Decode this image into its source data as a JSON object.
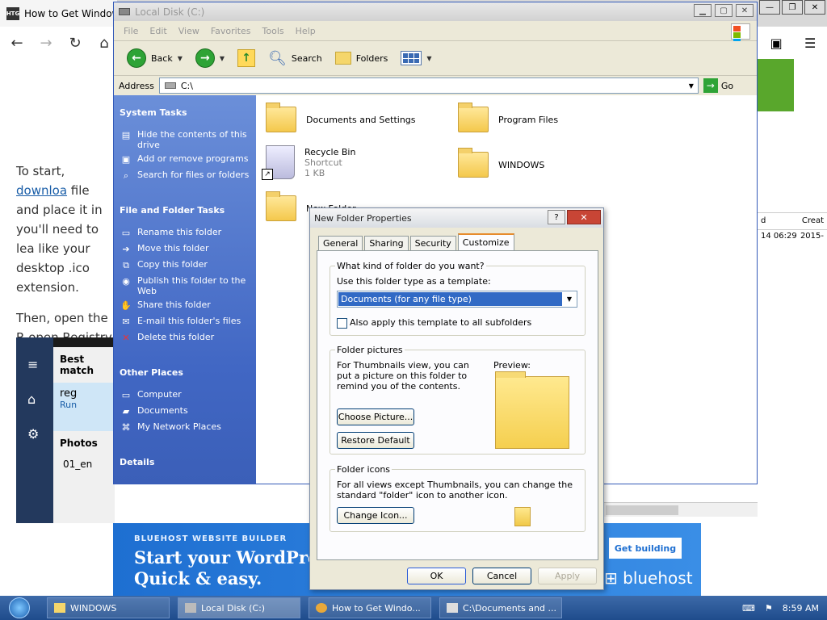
{
  "browser": {
    "tab_title": "How to Get Windows",
    "favicon": "HTG",
    "article": {
      "p1_prefix": "To start, ",
      "p1_link": "downloa",
      "p1_rest": "file and place it in you'll need to lea like your desktop .ico extension.",
      "p2": "Then, open the R open Registry Edi"
    },
    "search_panel": {
      "best_match": "Best match",
      "result": "reg",
      "result_sub": "Run",
      "photos": "Photos",
      "photo_item": "01_en"
    },
    "right_panel": {
      "col1": "d",
      "col2": "Creat",
      "row_date": "14 06:29",
      "row_year": "2015-"
    },
    "ad": {
      "tagline": "BLUEHOST WEBSITE BUILDER",
      "headline1": "Start your WordPre",
      "headline2": "Quick & easy.",
      "cta": "Get building",
      "logo": "bluehost"
    }
  },
  "explorer": {
    "title": "Local Disk (C:)",
    "menu": [
      "File",
      "Edit",
      "View",
      "Favorites",
      "Tools",
      "Help"
    ],
    "toolbar": {
      "back": "Back",
      "search": "Search",
      "folders": "Folders"
    },
    "address_label": "Address",
    "address_value": "C:\\",
    "go": "Go",
    "system_tasks": {
      "heading": "System Tasks",
      "items": [
        "Hide the contents of this drive",
        "Add or remove programs",
        "Search for files or folders"
      ]
    },
    "folder_tasks": {
      "heading": "File and Folder Tasks",
      "items": [
        "Rename this folder",
        "Move this folder",
        "Copy this folder",
        "Publish this folder to the Web",
        "Share this folder",
        "E-mail this folder's files",
        "Delete this folder"
      ]
    },
    "other_places": {
      "heading": "Other Places",
      "items": [
        "Computer",
        "Documents",
        "My Network Places"
      ]
    },
    "details_heading": "Details",
    "files": {
      "f1": "Documents and Settings",
      "f2": "Program Files",
      "bin_name": "Recycle Bin",
      "bin_type": "Shortcut",
      "bin_size": "1 KB",
      "f4": "WINDOWS",
      "f5": "New Folder"
    }
  },
  "dialog": {
    "title": "New Folder Properties",
    "tabs": [
      "General",
      "Sharing",
      "Security",
      "Customize"
    ],
    "group1_label": "What kind of folder do you want?",
    "template_label": "Use this folder type as a template:",
    "template_value": "Documents (for any file type)",
    "apply_all": "Also apply this template to all subfolders",
    "group2_label": "Folder pictures",
    "pictures_desc": "For Thumbnails view, you can put a picture on this folder to remind you of the contents.",
    "preview_label": "Preview:",
    "choose_picture": "Choose Picture...",
    "restore_default": "Restore Default",
    "group3_label": "Folder icons",
    "icons_desc": "For all views except Thumbnails, you can change the standard \"folder\" icon to another icon.",
    "change_icon": "Change Icon...",
    "ok": "OK",
    "cancel": "Cancel",
    "apply": "Apply"
  },
  "taskbar": {
    "items": [
      "WINDOWS",
      "Local Disk (C:)",
      "How to Get Windo...",
      "C:\\Documents and ..."
    ],
    "clock": "8:59 AM"
  },
  "colors": {
    "xp_blue": "#0a246a",
    "taskpane": "#4167c4",
    "selection": "#316ac5",
    "close_red": "#c84535"
  }
}
